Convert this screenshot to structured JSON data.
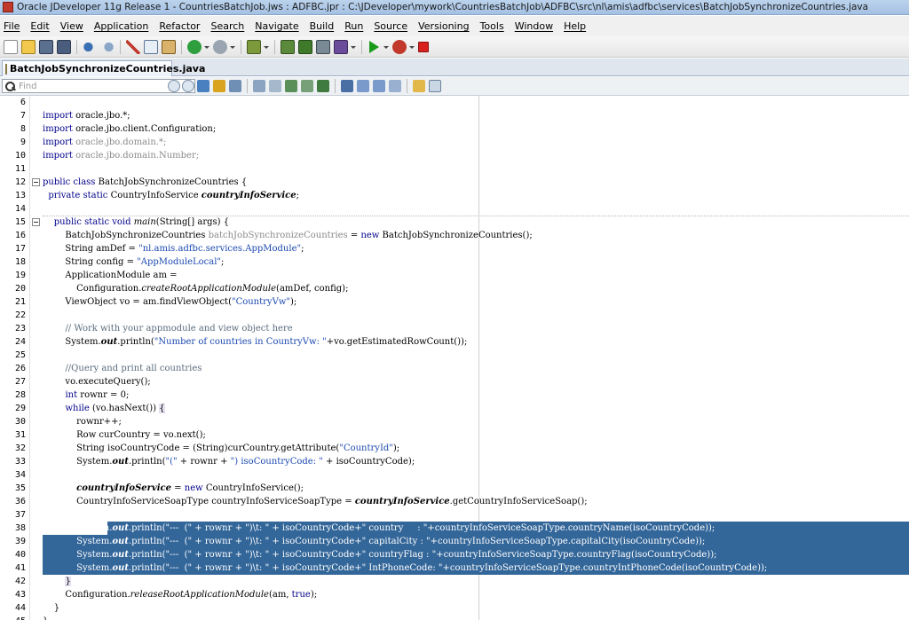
{
  "window": {
    "title": "Oracle JDeveloper 11g Release 1 - CountriesBatchJob.jws : ADFBC.jpr : C:\\JDeveloper\\mywork\\CountriesBatchJob\\ADFBC\\src\\nl\\amis\\adfbc\\services\\BatchJobSynchronizeCountries.java"
  },
  "menu": [
    "File",
    "Edit",
    "View",
    "Application",
    "Refactor",
    "Search",
    "Navigate",
    "Build",
    "Run",
    "Source",
    "Versioning",
    "Tools",
    "Window",
    "Help"
  ],
  "toolbar": {
    "icons": [
      "new-file-icon",
      "open-folder-icon",
      "save-icon",
      "save-all-icon",
      "undo-icon",
      "redo-icon",
      "cut-icon",
      "copy-icon",
      "paste-icon",
      "back-icon",
      "forward-icon",
      "deploy-icon",
      "make-icon",
      "rebuild-icon",
      "build-dropdown-icon",
      "profile-icon",
      "run-icon",
      "debug-icon",
      "stop-icon"
    ],
    "colors": {
      "background": "#ececec",
      "run": "#1a9a1a",
      "stop": "#d9211e"
    }
  },
  "tabs": [
    {
      "label": "BatchJobSynchronizeCountries.java",
      "active": true
    }
  ],
  "find": {
    "placeholder": "Find"
  },
  "editor": {
    "selection_color": "#336699",
    "lines": [
      {
        "n": "6",
        "html": ""
      },
      {
        "n": "7",
        "html": "<span class=\"kw\">import</span> oracle.jbo.*;"
      },
      {
        "n": "8",
        "html": "<span class=\"kw\">import</span> oracle.jbo.client.Configuration;"
      },
      {
        "n": "9",
        "html": "<span class=\"kw\">import</span> <span class=\"gr\">oracle.jbo.domain.*;</span>"
      },
      {
        "n": "10",
        "html": "<span class=\"kw\">import</span> <span class=\"gr\">oracle.jbo.domain.Number;</span>"
      },
      {
        "n": "11",
        "html": ""
      },
      {
        "n": "12",
        "html": "<span class=\"kw\">public class</span> BatchJobSynchronizeCountries {",
        "fold": true
      },
      {
        "n": "13",
        "html": "  <span class=\"kw\">private static</span> CountryInfoService <span class=\"bi\">countryInfoService</span>;"
      },
      {
        "n": "14",
        "html": ""
      },
      {
        "n": "15",
        "html": "    <span class=\"kw\">public static void</span> <span class=\"it\">main</span>(String[] args) {",
        "fold": true,
        "sep": true
      },
      {
        "n": "16",
        "html": "        BatchJobSynchronizeCountries <span class=\"gr\">batchJobSynchronizeCountries</span> = <span class=\"kw\">new</span> BatchJobSynchronizeCountries();"
      },
      {
        "n": "17",
        "html": "        String amDef = <span class=\"str\">\"nl.amis.adfbc.services.AppModule\"</span>;"
      },
      {
        "n": "18",
        "html": "        String config = <span class=\"str\">\"AppModuleLocal\"</span>;"
      },
      {
        "n": "19",
        "html": "        ApplicationModule am ="
      },
      {
        "n": "20",
        "html": "            Configuration.<span class=\"it\">createRootApplicationModule</span>(amDef, config);"
      },
      {
        "n": "21",
        "html": "        ViewObject vo = am.findViewObject(<span class=\"str\">\"CountryVw\"</span>);"
      },
      {
        "n": "22",
        "html": ""
      },
      {
        "n": "23",
        "html": "        <span class=\"cm\">// Work with your appmodule and view object here</span>"
      },
      {
        "n": "24",
        "html": "        System.<span class=\"bi\">out</span>.println(<span class=\"str\">\"Number of countries in CountryVw: \"</span>+vo.getEstimatedRowCount());"
      },
      {
        "n": "25",
        "html": ""
      },
      {
        "n": "26",
        "html": "        <span class=\"cm\">//Query and print all countries</span>"
      },
      {
        "n": "27",
        "html": "        vo.executeQuery();"
      },
      {
        "n": "28",
        "html": "        <span class=\"kw\">int</span> rownr = 0;"
      },
      {
        "n": "29",
        "html": "        <span class=\"kw\">while</span> (vo.hasNext()) <span class=\"mb\">{</span>"
      },
      {
        "n": "30",
        "html": "            rownr++;"
      },
      {
        "n": "31",
        "html": "            Row curCountry = vo.next();"
      },
      {
        "n": "32",
        "html": "            String isoCountryCode = (String)curCountry.getAttribute(<span class=\"str\">\"CountryId\"</span>);"
      },
      {
        "n": "33",
        "html": "            System.<span class=\"bi\">out</span>.println(<span class=\"str\">\"(\"</span> + rownr + <span class=\"str\">\") isoCountryCode: \"</span> + isoCountryCode);"
      },
      {
        "n": "34",
        "html": ""
      },
      {
        "n": "35",
        "html": "            <span class=\"bi\">countryInfoService</span> = <span class=\"kw\">new</span> CountryInfoService();"
      },
      {
        "n": "36",
        "html": "            CountryInfoServiceSoapType countryInfoServiceSoapType = <span class=\"bi\">countryInfoService</span>.getCountryInfoServiceSoap();"
      },
      {
        "n": "37",
        "html": ""
      },
      {
        "n": "38",
        "html": "            System.<span class=\"bi\">out</span>.println(\"---  (\" + rownr + \")\\t: \" + isoCountryCode+\" country     : \"+countryInfoServiceSoapType.countryName(isoCountryCode));",
        "sel": "partial"
      },
      {
        "n": "39",
        "html": "            System.<span class=\"bi\">out</span>.println(\"---  (\" + rownr + \")\\t: \" + isoCountryCode+\" capitalCity : \"+countryInfoServiceSoapType.capitalCity(isoCountryCode));",
        "sel": "full"
      },
      {
        "n": "40",
        "html": "            System.<span class=\"bi\">out</span>.println(\"---  (\" + rownr + \")\\t: \" + isoCountryCode+\" countryFlag : \"+countryInfoServiceSoapType.countryFlag(isoCountryCode));",
        "sel": "full"
      },
      {
        "n": "41",
        "html": "            System.<span class=\"bi\">out</span>.println(\"---  (\" + rownr + \")\\t: \" + isoCountryCode+\" IntPhoneCode: \"+countryInfoServiceSoapType.countryIntPhoneCode(isoCountryCode));",
        "sel": "full"
      },
      {
        "n": "42",
        "html": "        <span class=\"mb\">}</span>"
      },
      {
        "n": "43",
        "html": "        Configuration.<span class=\"it\">releaseRootApplicationModule</span>(am, <span class=\"kw\">true</span>);"
      },
      {
        "n": "44",
        "html": "    }"
      },
      {
        "n": "45",
        "html": "}"
      }
    ]
  }
}
